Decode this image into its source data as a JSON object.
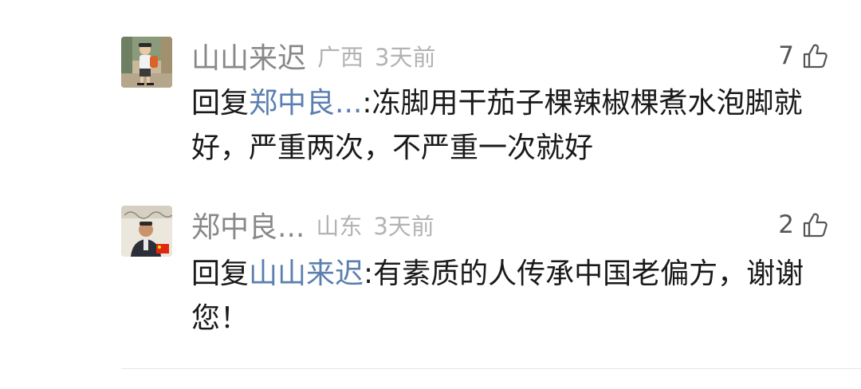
{
  "comments": [
    {
      "username": "山山来迟",
      "location": "广西",
      "time": "3天前",
      "likes": "7",
      "reply_prefix": "回复",
      "reply_to": "郑中良...",
      "text": ":冻脚用干茄子棵辣椒棵煮水泡脚就好，严重两次，不严重一次就好",
      "avatar_icon": "person-with-backpack-photo"
    },
    {
      "username": "郑中良...",
      "location": "山东",
      "time": "3天前",
      "likes": "2",
      "reply_prefix": "回复",
      "reply_to": "山山来迟",
      "text": ":有素质的人传承中国老偏方，谢谢您！",
      "avatar_icon": "man-portrait-with-flag-photo"
    }
  ],
  "colors": {
    "username": "#888888",
    "meta": "#b3b3b3",
    "body": "#1a1a1a",
    "mention": "#5b7fb0",
    "like_icon": "#555555"
  },
  "icons": {
    "like": "thumbs-up-icon"
  }
}
